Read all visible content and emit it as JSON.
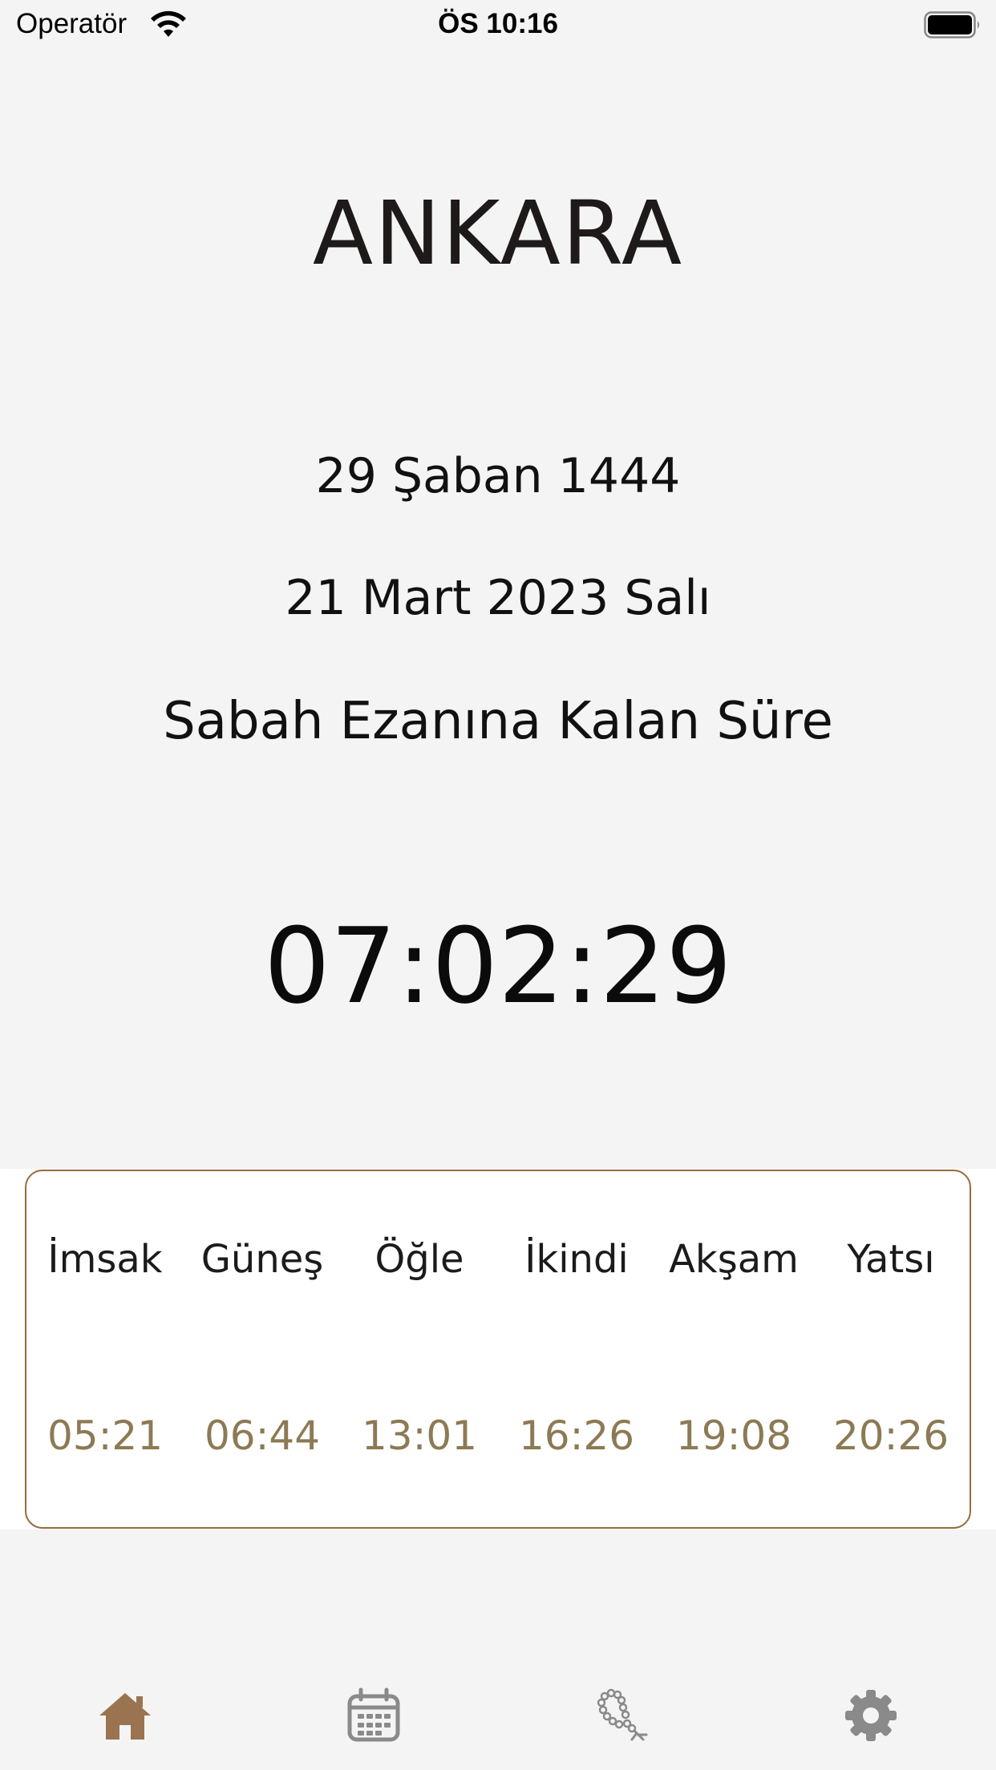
{
  "status_bar": {
    "carrier": "Operatör",
    "time": "ÖS 10:16"
  },
  "city": "ANKARA",
  "hijri_date": "29 Şaban 1444",
  "gregorian_date": "21 Mart 2023 Salı",
  "countdown_label": "Sabah Ezanına Kalan Süre",
  "countdown": "07:02:29",
  "prayer_times": [
    {
      "name": "İmsak",
      "time": "05:21"
    },
    {
      "name": "Güneş",
      "time": "06:44"
    },
    {
      "name": "Öğle",
      "time": "13:01"
    },
    {
      "name": "İkindi",
      "time": "16:26"
    },
    {
      "name": "Akşam",
      "time": "19:08"
    },
    {
      "name": "Yatsı",
      "time": "20:26"
    }
  ],
  "tabs": [
    {
      "icon": "home-icon",
      "active": true
    },
    {
      "icon": "calendar-icon",
      "active": false
    },
    {
      "icon": "prayer-beads-icon",
      "active": false
    },
    {
      "icon": "gear-icon",
      "active": false
    }
  ],
  "colors": {
    "accent": "#9a6a3b",
    "time_text": "#8c7a54",
    "tab_active": "#9a7451",
    "tab_inactive": "#8a8a8a",
    "background": "#f4f4f4"
  }
}
